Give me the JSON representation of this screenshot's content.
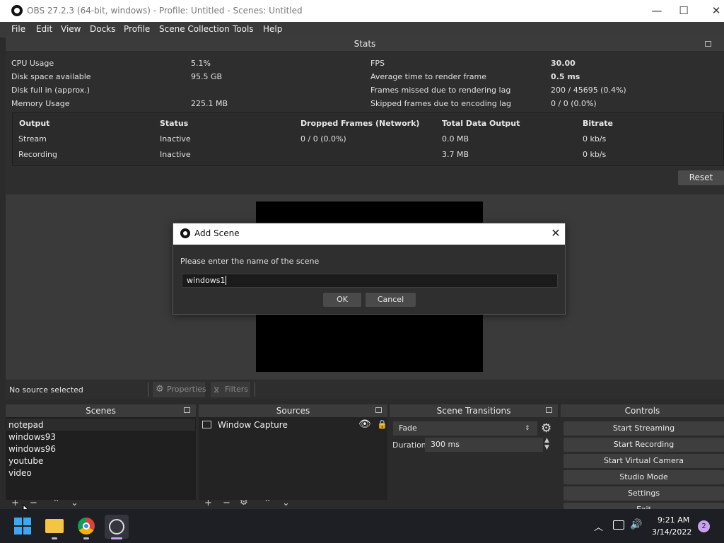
{
  "window": {
    "title": "OBS 27.2.3 (64-bit, windows) - Profile: Untitled - Scenes: Untitled"
  },
  "menu": [
    "File",
    "Edit",
    "View",
    "Docks",
    "Profile",
    "Scene Collection",
    "Tools",
    "Help"
  ],
  "stats": {
    "title": "Stats",
    "left": [
      {
        "label": "CPU Usage",
        "value": "5.1%"
      },
      {
        "label": "Disk space available",
        "value": "95.5 GB"
      },
      {
        "label": "Disk full in (approx.)",
        "value": ""
      },
      {
        "label": "Memory Usage",
        "value": "225.1 MB"
      }
    ],
    "right": [
      {
        "label": "FPS",
        "value": "30.00"
      },
      {
        "label": "Average time to render frame",
        "value": "0.5 ms"
      },
      {
        "label": "Frames missed due to rendering lag",
        "value": "200 / 45695 (0.4%)"
      },
      {
        "label": "Skipped frames due to encoding lag",
        "value": "0 / 0 (0.0%)"
      }
    ],
    "table": {
      "headers": [
        "Output",
        "Status",
        "Dropped Frames (Network)",
        "Total Data Output",
        "Bitrate"
      ],
      "rows": [
        [
          "Stream",
          "Inactive",
          "0 / 0 (0.0%)",
          "0.0 MB",
          "0 kb/s"
        ],
        [
          "Recording",
          "Inactive",
          "",
          "3.7 MB",
          "0 kb/s"
        ]
      ]
    },
    "reset_label": "Reset"
  },
  "dialog": {
    "title": "Add Scene",
    "prompt": "Please enter the name of the scene",
    "input_value": "windows1",
    "ok_label": "OK",
    "cancel_label": "Cancel"
  },
  "source_bar": {
    "status": "No source selected",
    "properties_label": "Properties",
    "filters_label": "Filters"
  },
  "docks": {
    "scenes": {
      "title": "Scenes",
      "items": [
        "notepad",
        "windows93",
        "windows96",
        "youtube",
        "video"
      ]
    },
    "sources": {
      "title": "Sources",
      "items": [
        "Window Capture"
      ]
    },
    "transitions": {
      "title": "Scene Transitions",
      "selected": "Fade",
      "duration_label": "Duration",
      "duration_value": "300 ms"
    },
    "controls": {
      "title": "Controls",
      "buttons": [
        "Start Streaming",
        "Start Recording",
        "Start Virtual Camera",
        "Studio Mode",
        "Settings",
        "Exit"
      ]
    }
  },
  "taskbar": {
    "time": "9:21 AM",
    "date": "3/14/2022",
    "notification_count": "2"
  }
}
